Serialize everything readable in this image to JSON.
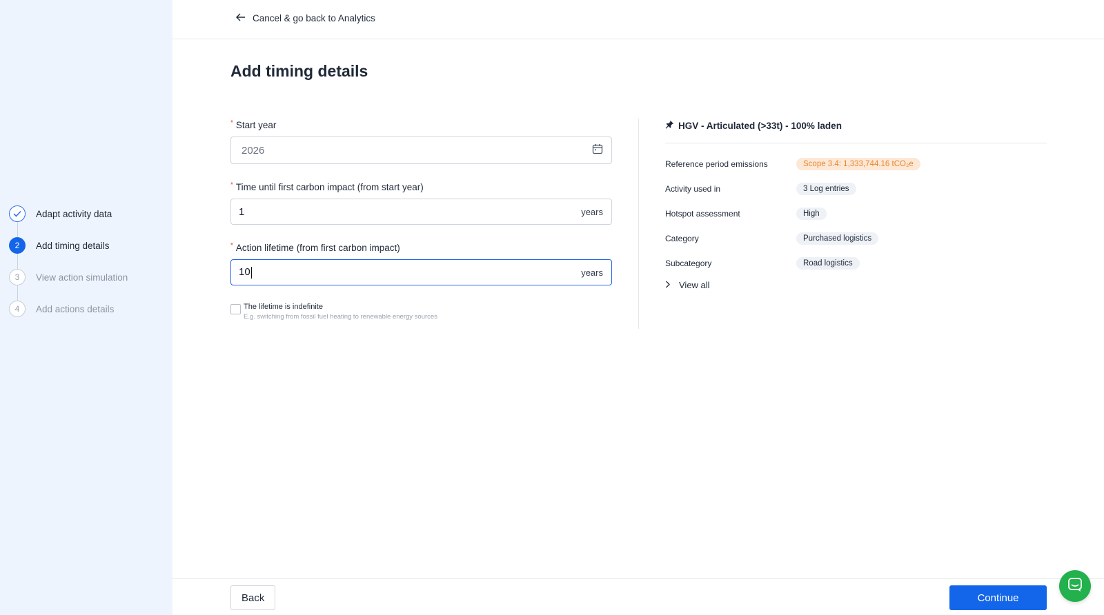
{
  "sidebar": {
    "steps": [
      {
        "number": "1",
        "label": "Adapt activity data",
        "status": "done"
      },
      {
        "number": "2",
        "label": "Add timing details",
        "status": "active"
      },
      {
        "number": "3",
        "label": "View action simulation",
        "status": "todo"
      },
      {
        "number": "4",
        "label": "Add actions details",
        "status": "todo"
      }
    ]
  },
  "header": {
    "back_link": "Cancel & go back to Analytics"
  },
  "page": {
    "title": "Add timing details"
  },
  "form": {
    "start_year": {
      "label": "Start year",
      "value": "2026",
      "icon": "calendar-icon"
    },
    "time_until_impact": {
      "label": "Time until first carbon impact (from start year)",
      "value": "1",
      "suffix": "years"
    },
    "action_lifetime": {
      "label": "Action lifetime (from first carbon impact)",
      "value": "10",
      "suffix": "years"
    },
    "indefinite": {
      "label": "The lifetime is indefinite",
      "hint": "E.g. switching from fossil fuel heating to renewable energy sources",
      "checked": false
    }
  },
  "panel": {
    "title": "HGV - Articulated (>33t) - 100% laden",
    "title_icon": "pin-icon",
    "properties": [
      {
        "label": "Reference period emissions",
        "value": "Scope 3.4: 1,333,744.16 tCO₂e"
      },
      {
        "label": "Activity used in",
        "value": "3 Log entries"
      },
      {
        "label": "Hotspot assessment",
        "value": "High"
      },
      {
        "label": "Category",
        "value": "Purchased logistics"
      },
      {
        "label": "Subcategory",
        "value": "Road logistics"
      }
    ],
    "view_all": "View all"
  },
  "footer": {
    "back_label": "Back",
    "continue_label": "Continue"
  },
  "colors": {
    "primary": "#1366e9",
    "sidebar_bg": "#eef4fd",
    "scope_tag_bg": "#fde8d6",
    "scope_tag_text": "#e8862f",
    "chat_green": "#22b14c"
  }
}
